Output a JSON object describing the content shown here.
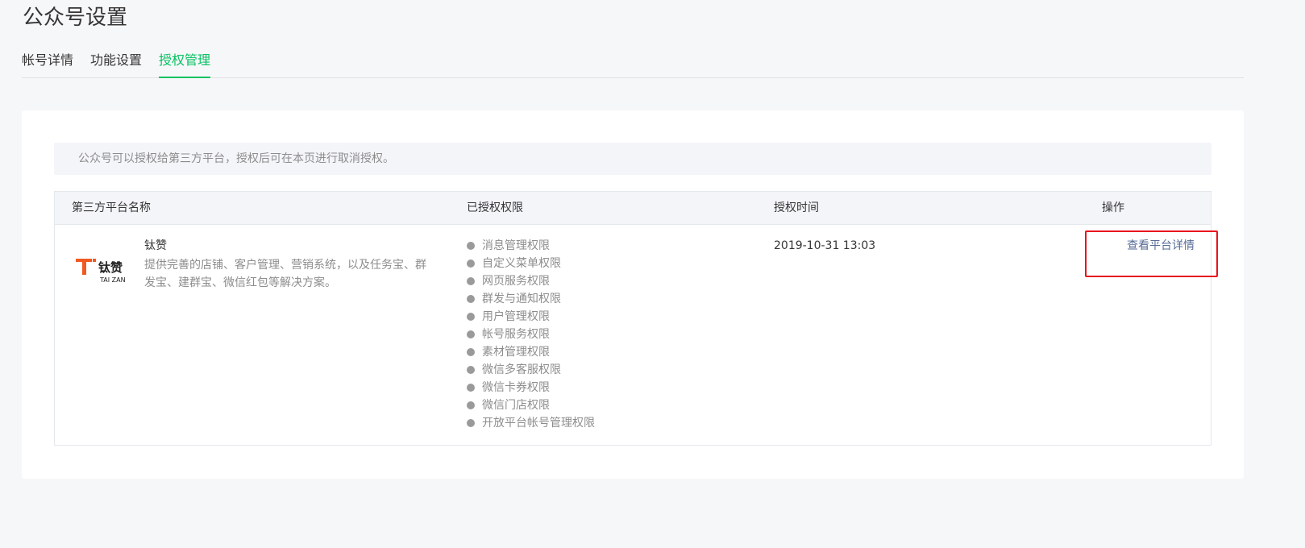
{
  "page": {
    "title": "公众号设置"
  },
  "tabs": [
    {
      "label": "帐号详情",
      "active": false
    },
    {
      "label": "功能设置",
      "active": false
    },
    {
      "label": "授权管理",
      "active": true
    }
  ],
  "notice": {
    "text": "公众号可以授权给第三方平台，授权后可在本页进行取消授权。"
  },
  "table": {
    "headers": [
      "第三方平台名称",
      "已授权权限",
      "授权时间",
      "操作"
    ],
    "rows": [
      {
        "logo": {
          "text_cn": "钛赞",
          "text_en": "TAI ZAN",
          "icon": "taizan-logo"
        },
        "name": "钛赞",
        "description": "提供完善的店铺、客户管理、营销系统，以及任务宝、群发宝、建群宝、微信红包等解决方案。",
        "permissions": [
          "消息管理权限",
          "自定义菜单权限",
          "网页服务权限",
          "群发与通知权限",
          "用户管理权限",
          "帐号服务权限",
          "素材管理权限",
          "微信多客服权限",
          "微信卡券权限",
          "微信门店权限",
          "开放平台帐号管理权限"
        ],
        "auth_time": "2019-10-31 13:03",
        "action_label": "查看平台详情"
      }
    ]
  },
  "colors": {
    "accent": "#07c160",
    "link": "#576b95",
    "highlight": "#e8141d",
    "logo_orange": "#f05a22"
  }
}
